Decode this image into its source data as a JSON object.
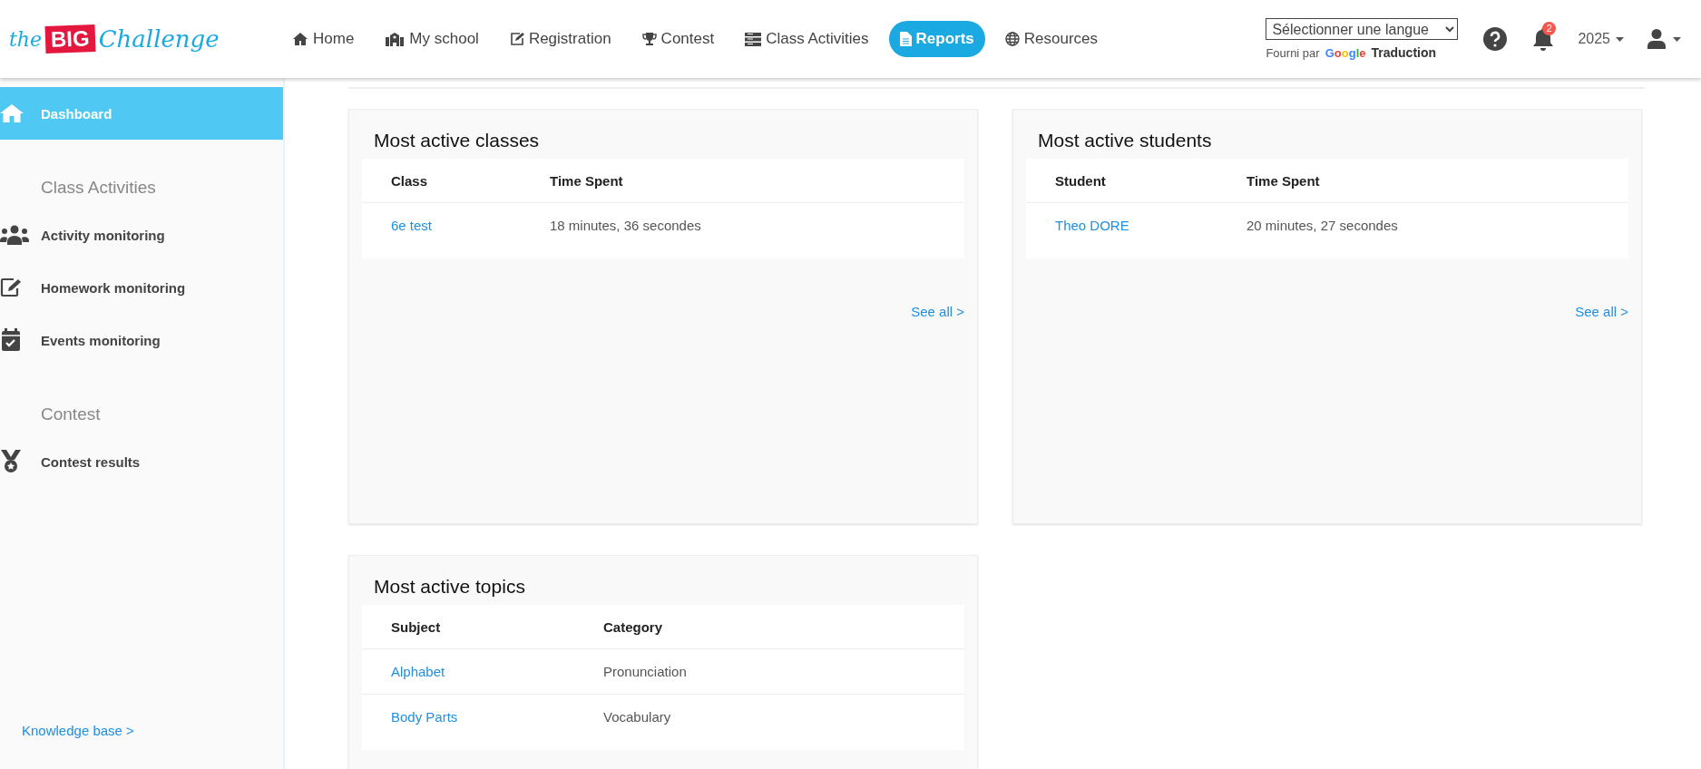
{
  "logo": {
    "prefix": "the",
    "highlight": "BIG",
    "suffix": "Challenge"
  },
  "nav": [
    {
      "label": "Home",
      "selected": false
    },
    {
      "label": "My school",
      "selected": false
    },
    {
      "label": "Registration",
      "selected": false
    },
    {
      "label": "Contest",
      "selected": false
    },
    {
      "label": "Class Activities",
      "selected": false
    },
    {
      "label": "Reports",
      "selected": true
    },
    {
      "label": "Resources",
      "selected": false
    }
  ],
  "language_select": {
    "value": "Sélectionner une langue",
    "powered_by": "Fourni par",
    "provider": "Google",
    "service": "Traduction"
  },
  "notifications": {
    "count": "2"
  },
  "year": "2025",
  "sidebar": {
    "items": [
      {
        "kind": "item",
        "label": "Dashboard",
        "selected": true
      },
      {
        "kind": "heading",
        "label": "Class Activities"
      },
      {
        "kind": "item",
        "label": "Activity monitoring",
        "selected": false
      },
      {
        "kind": "item",
        "label": "Homework monitoring",
        "selected": false
      },
      {
        "kind": "item",
        "label": "Events monitoring",
        "selected": false
      },
      {
        "kind": "heading",
        "label": "Contest"
      },
      {
        "kind": "item",
        "label": "Contest results",
        "selected": false
      }
    ],
    "footer_link": "Knowledge base >"
  },
  "cards": [
    {
      "title": "Most active classes",
      "columns": [
        "Class",
        "Time Spent"
      ],
      "rows": [
        [
          "6e test",
          "18 minutes, 36 secondes"
        ]
      ],
      "see_all": "See all >"
    },
    {
      "title": "Most active students",
      "columns": [
        "Student",
        "Time Spent"
      ],
      "rows": [
        [
          "Theo DORE",
          "20 minutes, 27 secondes"
        ]
      ],
      "see_all": "See all >"
    },
    {
      "title": "Most active topics",
      "columns": [
        "Subject",
        "Category"
      ],
      "rows": [
        [
          "Alphabet",
          "Pronunciation"
        ],
        [
          "Body Parts",
          "Vocabulary"
        ]
      ]
    }
  ]
}
